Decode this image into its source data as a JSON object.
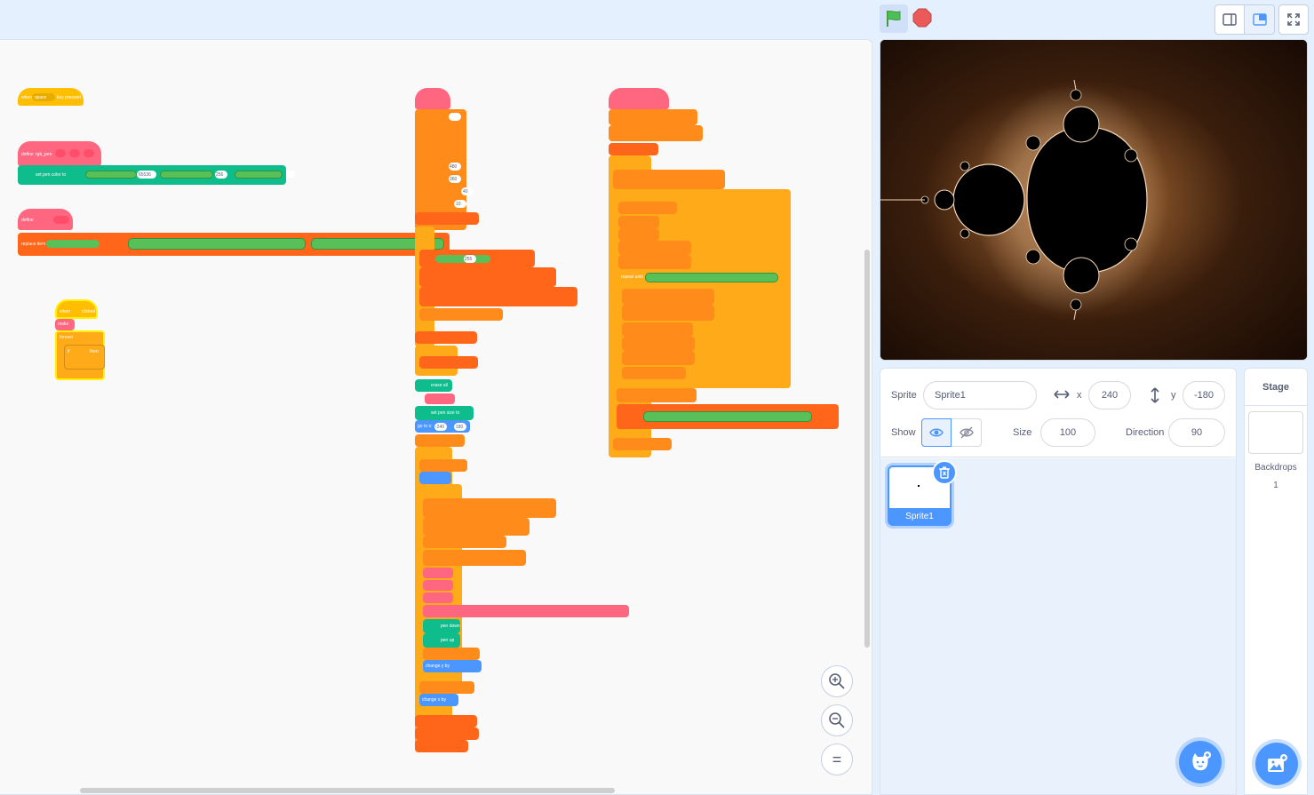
{
  "controls": {
    "green_flag": "green-flag-icon",
    "stop": "stop-sign-icon",
    "small_stage": "small-stage-icon",
    "normal_stage": "normal-stage-icon",
    "fullscreen": "fullscreen-icon"
  },
  "code_blocks": {
    "when_key_label": "when",
    "space_label": "space",
    "key_pressed_label": "key pressed",
    "define_label": "define",
    "rgb_pen_label": "rgb_pen",
    "set_pen_color_label": "set pen color to",
    "replace_item_label": "replace item",
    "when_flag_clicked_label": "when",
    "clicked_label": "clicked",
    "make_label": "make",
    "forever_label": "forever",
    "if_label": "if",
    "then_label": "then",
    "number_65536": "65536",
    "number_256": "256",
    "number_480": "480",
    "number_360": "360",
    "number_40": "40",
    "number_10": "10",
    "number_255": "255",
    "erase_all_label": "erase all",
    "set_pen_size_label": "set pen size to",
    "go_to_label": "go to x:",
    "number_neg240": "-240",
    "number_180": "180",
    "pen_down_label": "pen down",
    "pen_up_label": "pen up",
    "change_y_label": "change y by",
    "change_x_label": "change x by",
    "repeat_until_label": "repeat until"
  },
  "zoom": {
    "zoom_in": "zoom-in-icon",
    "zoom_out": "zoom-out-icon",
    "reset": "="
  },
  "sprite_info": {
    "sprite_label": "Sprite",
    "sprite_name": "Sprite1",
    "x_label": "x",
    "x_value": "240",
    "y_label": "y",
    "y_value": "-180",
    "show_label": "Show",
    "size_label": "Size",
    "size_value": "100",
    "direction_label": "Direction",
    "direction_value": "90"
  },
  "sprites": [
    {
      "name": "Sprite1"
    }
  ],
  "stage_pane": {
    "title": "Stage",
    "backdrops_label": "Backdrops",
    "backdrops_count": "1"
  },
  "colors": {
    "accent": "#4c97ff",
    "motion": "#4c97ff",
    "events": "#ffbf00",
    "control": "#ffab19",
    "operators": "#59c059",
    "variables": "#ff8c1a",
    "lists": "#ff661a",
    "my_blocks": "#ff6680",
    "pen": "#0fbd8c"
  }
}
